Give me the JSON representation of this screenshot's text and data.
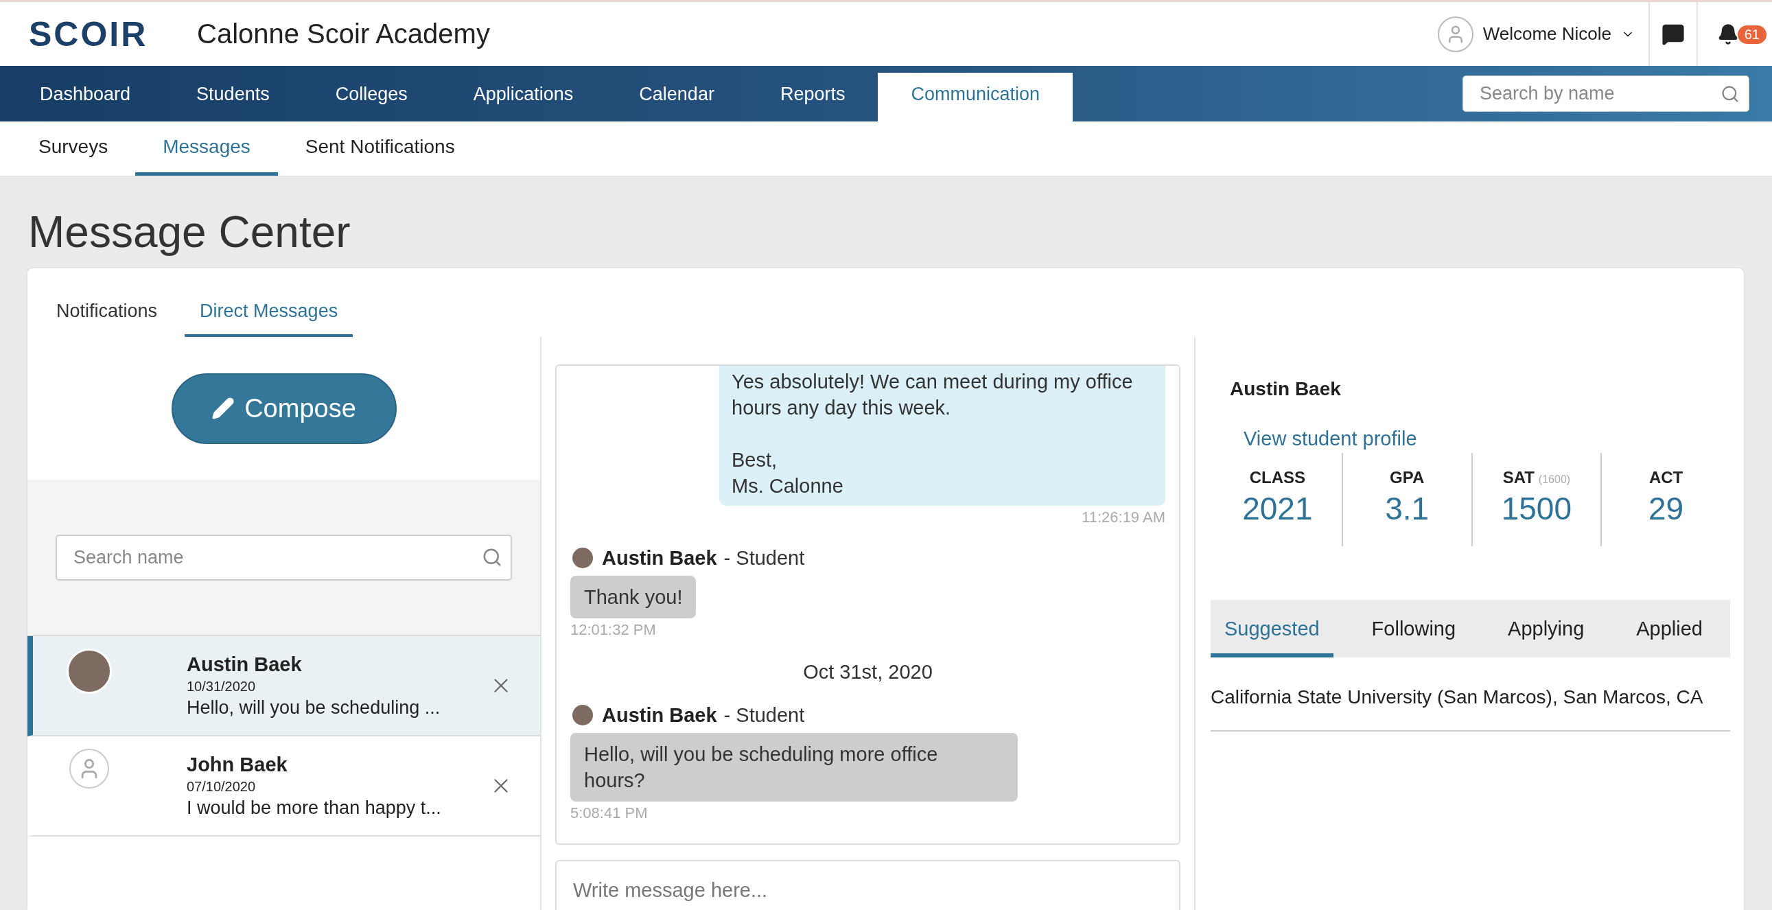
{
  "header": {
    "logo": "SCOIR",
    "school": "Calonne Scoir Academy",
    "welcome": "Welcome Nicole",
    "notification_count": "61"
  },
  "nav": {
    "items": [
      {
        "label": "Dashboard",
        "selected": false
      },
      {
        "label": "Students",
        "selected": false
      },
      {
        "label": "Colleges",
        "selected": false
      },
      {
        "label": "Applications",
        "selected": false
      },
      {
        "label": "Calendar",
        "selected": false
      },
      {
        "label": "Reports",
        "selected": false
      },
      {
        "label": "Communication",
        "selected": true
      }
    ],
    "search": {
      "placeholder": "Search by name"
    }
  },
  "subnav": [
    {
      "label": "Surveys",
      "selected": false
    },
    {
      "label": "Messages",
      "selected": true
    },
    {
      "label": "Sent Notifications",
      "selected": false
    }
  ],
  "page_title": "Message Center",
  "card_tabs": [
    {
      "label": "Notifications",
      "selected": false
    },
    {
      "label": "Direct Messages",
      "selected": true
    }
  ],
  "compose": {
    "label": "Compose"
  },
  "conversation_search": {
    "placeholder": "Search name"
  },
  "conversations": [
    {
      "kind": "photo",
      "name": "Austin Baek",
      "date": "10/31/2020",
      "preview": "Hello, will you be scheduling ...",
      "selected": true
    },
    {
      "kind": "generic",
      "name": "John Baek",
      "date": "07/10/2020",
      "preview": "I would be more than happy t...",
      "selected": false
    }
  ],
  "messages": [
    {
      "kind": "sent",
      "text": "Yes absolutely! We can meet during my office hours any day this week.\n\nBest,\nMs. Calonne",
      "time": "11:26:19 AM"
    },
    {
      "kind": "received",
      "sender": "Austin Baek",
      "role": "- Student",
      "text": "Thank you!",
      "time": "12:01:32 PM"
    },
    {
      "kind": "date",
      "text": "Oct 31st, 2020"
    },
    {
      "kind": "received",
      "sender": "Austin Baek",
      "role": "- Student",
      "text": "Hello, will you be scheduling more office hours?",
      "time": "5:08:41 PM"
    }
  ],
  "composer": {
    "placeholder": "Write message here..."
  },
  "profile": {
    "name": "Austin Baek",
    "link": "View student profile",
    "stats": [
      {
        "label": "CLASS",
        "value": "2021"
      },
      {
        "label": "GPA",
        "value": "3.1"
      },
      {
        "label": "SAT",
        "note": "(1600)",
        "value": "1500"
      },
      {
        "label": "ACT",
        "value": "29"
      }
    ],
    "tabs": [
      {
        "label": "Suggested",
        "selected": true
      },
      {
        "label": "Following",
        "selected": false
      },
      {
        "label": "Applying",
        "selected": false
      },
      {
        "label": "Applied",
        "selected": false
      }
    ],
    "colleges": [
      "California State University (San Marcos), San Marcos, CA"
    ]
  }
}
